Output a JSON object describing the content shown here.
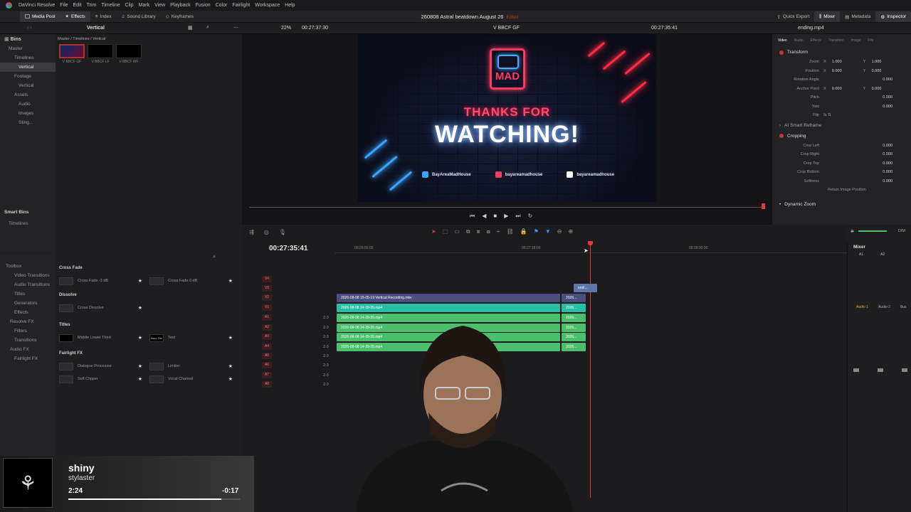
{
  "menubar": {
    "app": "DaVinci Resolve",
    "items": [
      "File",
      "Edit",
      "Trim",
      "Timeline",
      "Clip",
      "Mark",
      "View",
      "Playback",
      "Fusion",
      "Color",
      "Fairlight",
      "Workspace",
      "Help"
    ]
  },
  "toolbar": {
    "media_pool": "Media Pool",
    "effects": "Effects",
    "index": "Index",
    "sound_library": "Sound Library",
    "keyframes": "Keyframes",
    "project_title": "260808 Astral beatdown August 26",
    "edited": "Edited",
    "quick_export": "Quick Export",
    "mixer": "Mixer",
    "metadata": "Metadata",
    "inspector": "Inspector"
  },
  "subbar": {
    "bin_name": "Vertical",
    "zoom": "22%",
    "timecode_left": "00:27:37:30",
    "timeline_name": "V BBCF GF",
    "timecode_right": "00:27:35:41",
    "clip_name": "ending.mp4"
  },
  "bins": {
    "header": "Bins",
    "path": "Master / Timelines / Vertical",
    "tree": [
      "Master",
      "Timelines",
      "Vertical",
      "Footage",
      "Vertical",
      "Assets",
      "Audio",
      "Images",
      "Sting..."
    ],
    "smart_bins": "Smart Bins",
    "smart_items": [
      "Timelines"
    ],
    "thumbs": [
      "V BBCF GF",
      "V BBCF LF",
      "V BBCF WF"
    ]
  },
  "toolbox": {
    "items": [
      "Toolbox",
      "Video Transitions",
      "Audio Transitions",
      "Titles",
      "Generators",
      "Effects",
      "Resolve FX",
      "Filters",
      "Transitions",
      "Audio FX",
      "Fairlight FX"
    ]
  },
  "effects": {
    "cross_fade": "Cross Fade",
    "cf1": "Cross Fade -3 dB",
    "cf2": "Cross Fade 0 dB",
    "dissolve": "Dissolve",
    "cross_dissolve": "Cross Dissolve",
    "titles": "Titles",
    "mlt": "Middle Lower Third",
    "text": "Text",
    "basic_title": "Basic Title",
    "fairlight_fx": "Fairlight FX",
    "dialogue": "Dialogue Processor",
    "limiter": "Limiter",
    "soft_clipper": "Soft Clipper",
    "vocal": "Vocal Channel"
  },
  "frame": {
    "logo": "MAD",
    "thanks": "THANKS FOR",
    "watching": "WATCHING!",
    "social1": "BayAreaMadHouse",
    "social2": "bayareamadhouse",
    "social3": "bayareamadhouse"
  },
  "inspector": {
    "tabs": [
      "Video",
      "Audio",
      "Effects",
      "Transition",
      "Image",
      "File"
    ],
    "transform": "Transform",
    "rows": [
      [
        "Zoom",
        "X",
        "1.000",
        "Y",
        "1.000"
      ],
      [
        "Position",
        "X",
        "0.000",
        "Y",
        "0.000"
      ],
      [
        "Rotation Angle",
        "",
        "",
        "",
        "0.000"
      ],
      [
        "Anchor Point",
        "X",
        "0.000",
        "Y",
        "0.000"
      ],
      [
        "Pitch",
        "",
        "",
        "",
        "0.000"
      ],
      [
        "Yaw",
        "",
        "",
        "",
        "0.000"
      ],
      [
        "Flip",
        "",
        "",
        "",
        ""
      ]
    ],
    "smart_reframe": "AI Smart Reframe",
    "cropping": "Cropping",
    "crop_rows": [
      [
        "Crop Left",
        "0.000"
      ],
      [
        "Crop Right",
        "0.000"
      ],
      [
        "Crop Top",
        "0.000"
      ],
      [
        "Crop Bottom",
        "0.000"
      ],
      [
        "Softness",
        "0.000"
      ]
    ],
    "retain": "Retain Image Position",
    "dynamic_zoom": "Dynamic Zoom"
  },
  "timeline": {
    "timecode": "00:27:35:41",
    "ruler": [
      "00:26:56:00",
      "00:27:18:00",
      "00:28:00:00"
    ],
    "tracks": [
      "V4",
      "V3",
      "V2",
      "V1",
      "A1",
      "A2",
      "A3",
      "A4",
      "A5",
      "A6",
      "A7",
      "A8"
    ],
    "level": "2.0",
    "clips": {
      "v2": "2026-08-08 15-05-19 Vertical Recording.mkv",
      "v1": "2026-08-08 14-39-35.mp4",
      "a": "2026-08-08 14-39-35.mp4",
      "short": "2026...",
      "ending": "endi..."
    }
  },
  "mixer": {
    "title": "Mixer",
    "channels": [
      "A1",
      "A2"
    ],
    "buses": [
      "Audio 1",
      "Audio 2",
      "Bus"
    ],
    "dim": "DIM"
  },
  "nowplaying": {
    "title": "shiny",
    "artist": "stylaster",
    "elapsed": "2:24",
    "remaining": "-0:17",
    "progress": 0.89
  },
  "colors": {
    "accent": "#27bfa3",
    "audio": "#4cbf6c",
    "playhead": "#e23a3a"
  }
}
